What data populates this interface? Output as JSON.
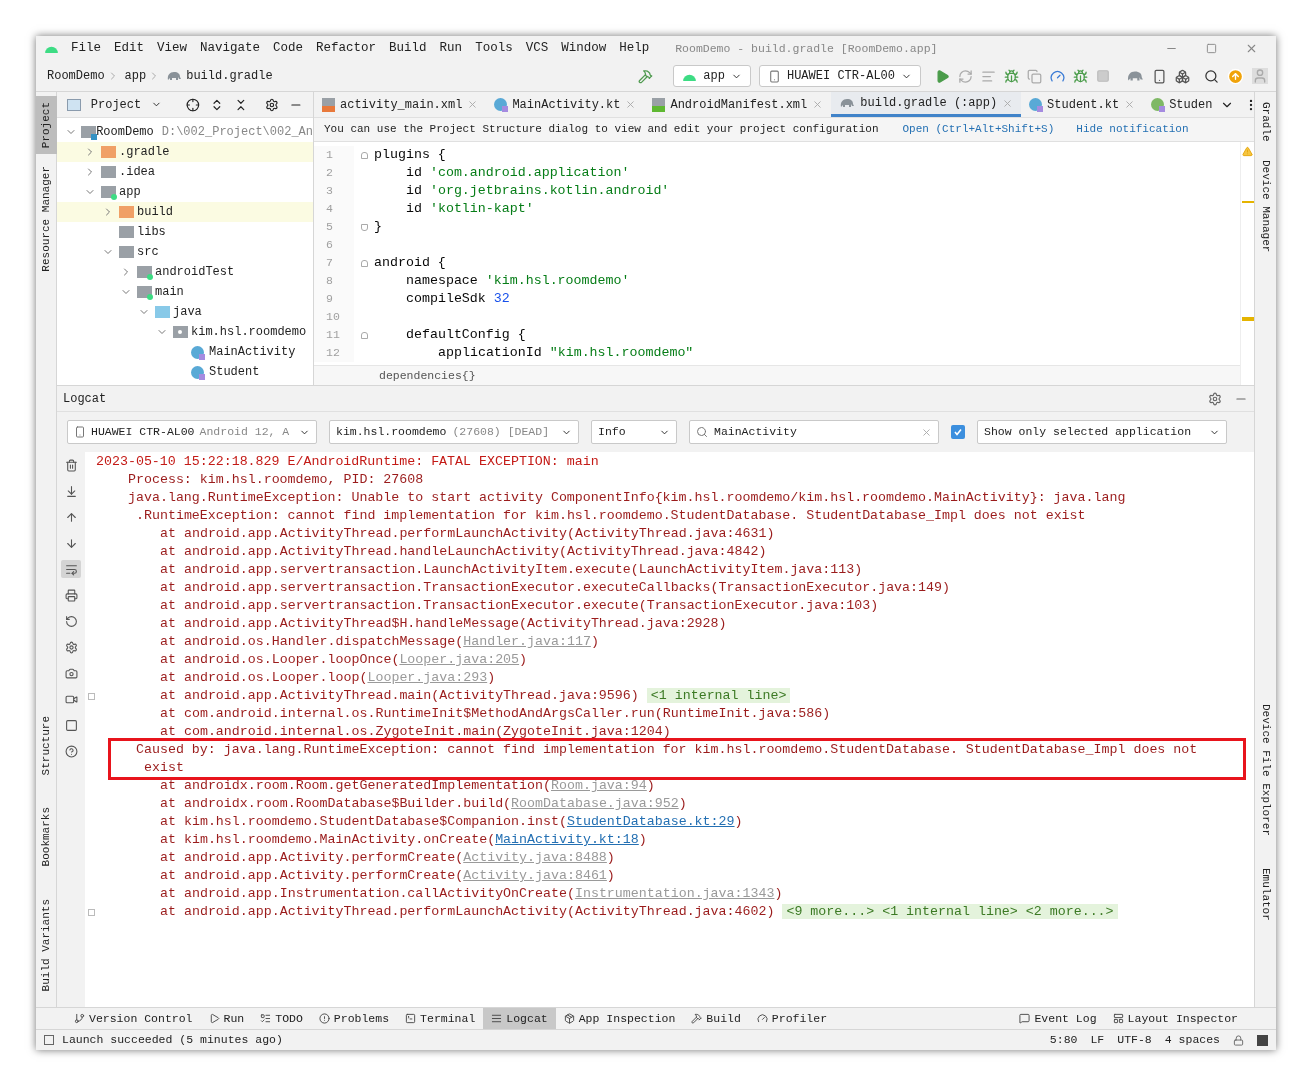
{
  "window": {
    "title": "RoomDemo - build.gradle [RoomDemo.app]"
  },
  "menu": [
    "File",
    "Edit",
    "View",
    "Navigate",
    "Code",
    "Refactor",
    "Build",
    "Run",
    "Tools",
    "VCS",
    "Window",
    "Help"
  ],
  "breadcrumbs": [
    {
      "label": "RoomDemo",
      "kind": "project"
    },
    {
      "label": "app",
      "kind": "module"
    },
    {
      "label": "build.gradle",
      "kind": "gradle"
    }
  ],
  "run_toolbar": {
    "config": "app",
    "device": "HUAWEI CTR-AL00"
  },
  "left_stripe_top": [
    {
      "label": "Project",
      "selected": true
    },
    {
      "label": "Resource Manager",
      "selected": false
    }
  ],
  "left_stripe_bottom": [
    {
      "label": "Structure",
      "selected": false
    },
    {
      "label": "Bookmarks",
      "selected": false
    },
    {
      "label": "Build Variants",
      "selected": false
    }
  ],
  "right_stripe_top": [
    {
      "label": "Gradle",
      "selected": false
    },
    {
      "label": "Device Manager",
      "selected": false
    }
  ],
  "right_stripe_bottom": [
    {
      "label": "Device File Explorer",
      "selected": false
    },
    {
      "label": "Emulator",
      "selected": false
    }
  ],
  "project_panel": {
    "view": "Project",
    "tree": [
      {
        "label": "RoomDemo",
        "detail": "D:\\002_Project\\002_An",
        "kind": "project",
        "expanded": true,
        "children": [
          {
            "label": ".gradle",
            "kind": "excluded",
            "expanded": false
          },
          {
            "label": ".idea",
            "kind": "folder",
            "expanded": false
          },
          {
            "label": "app",
            "kind": "module",
            "expanded": true,
            "children": [
              {
                "label": "build",
                "kind": "excluded",
                "expanded": false
              },
              {
                "label": "libs",
                "kind": "folder"
              },
              {
                "label": "src",
                "kind": "folder",
                "expanded": true,
                "children": [
                  {
                    "label": "androidTest",
                    "kind": "module",
                    "expanded": false
                  },
                  {
                    "label": "main",
                    "kind": "module",
                    "expanded": true,
                    "children": [
                      {
                        "label": "java",
                        "kind": "source",
                        "expanded": true,
                        "children": [
                          {
                            "label": "kim.hsl.roomdemo",
                            "kind": "package",
                            "expanded": true,
                            "children": [
                              {
                                "label": "MainActivity",
                                "kind": "class"
                              },
                              {
                                "label": "Student",
                                "kind": "class"
                              }
                            ]
                          }
                        ]
                      }
                    ]
                  }
                ]
              }
            ]
          }
        ]
      }
    ]
  },
  "editor": {
    "tabs": [
      {
        "label": "activity_main.xml",
        "kind": "xml",
        "selected": false,
        "closable": true
      },
      {
        "label": "MainActivity.kt",
        "kind": "class",
        "selected": false,
        "closable": true
      },
      {
        "label": "AndroidManifest.xml",
        "kind": "manifest",
        "selected": false,
        "closable": true
      },
      {
        "label": "build.gradle (:app)",
        "kind": "gradle",
        "selected": true,
        "closable": true
      },
      {
        "label": "Student.kt",
        "kind": "class",
        "selected": false,
        "closable": true
      },
      {
        "label": "Studen",
        "kind": "interface",
        "selected": false,
        "closable": false
      }
    ],
    "notification": {
      "text": "You can use the Project Structure dialog to view and edit your project configuration",
      "actions": [
        "Open (Ctrl+Alt+Shift+S)",
        "Hide notification"
      ]
    },
    "lines": [
      {
        "number": "1",
        "kind": "block-start",
        "tokens": [
          {
            "text": "plugins {",
            "kind": "plain"
          }
        ]
      },
      {
        "number": "2",
        "kind": "body",
        "tokens": [
          {
            "text": "id ",
            "kind": "plain"
          },
          {
            "text": "'com.android.application'",
            "kind": "string"
          }
        ]
      },
      {
        "number": "3",
        "kind": "body",
        "tokens": [
          {
            "text": "id ",
            "kind": "plain"
          },
          {
            "text": "'org.jetbrains.kotlin.android'",
            "kind": "string"
          }
        ]
      },
      {
        "number": "4",
        "kind": "body",
        "tokens": [
          {
            "text": "id ",
            "kind": "plain"
          },
          {
            "text": "'kotlin-kapt'",
            "kind": "string"
          }
        ]
      },
      {
        "number": "5",
        "kind": "block-end",
        "tokens": [
          {
            "text": "}",
            "kind": "plain"
          }
        ]
      },
      {
        "number": "6",
        "kind": "blank"
      },
      {
        "number": "7",
        "kind": "block-start",
        "tokens": [
          {
            "text": "android {",
            "kind": "plain"
          }
        ]
      },
      {
        "number": "8",
        "kind": "body",
        "tokens": [
          {
            "text": "namespace ",
            "kind": "plain"
          },
          {
            "text": "'kim.hsl.roomdemo'",
            "kind": "string"
          }
        ]
      },
      {
        "number": "9",
        "kind": "body",
        "tokens": [
          {
            "text": "compileSdk ",
            "kind": "plain"
          },
          {
            "text": "32",
            "kind": "number"
          }
        ]
      },
      {
        "number": "10",
        "kind": "blank"
      },
      {
        "number": "11",
        "kind": "nested-block-start",
        "tokens": [
          {
            "text": "defaultConfig {",
            "kind": "plain"
          }
        ]
      },
      {
        "number": "12",
        "kind": "nested-body",
        "tokens": [
          {
            "text": "applicationId ",
            "kind": "plain"
          },
          {
            "text": "\"kim.hsl.roomdemo\"",
            "kind": "string"
          }
        ]
      }
    ],
    "breadcrumb": "dependencies{}"
  },
  "logcat": {
    "title": "Logcat",
    "device": {
      "name": "HUAWEI CTR-AL00",
      "detail": "Android 12, A"
    },
    "process": {
      "name": "kim.hsl.roomdemo",
      "detail": "(27608) [DEAD]"
    },
    "level": "Info",
    "search": "MainActivity",
    "filter_checkbox": {
      "checked": true
    },
    "scope": "Show only selected application",
    "toolbar": [
      {
        "kind": "clear",
        "selected": false
      },
      {
        "kind": "scroll-end",
        "selected": false
      },
      {
        "kind": "up",
        "selected": false
      },
      {
        "kind": "down",
        "selected": false
      },
      {
        "kind": "wrap",
        "selected": true
      },
      {
        "kind": "print",
        "selected": false
      },
      {
        "kind": "restart",
        "selected": false
      },
      {
        "kind": "settings",
        "selected": false
      },
      {
        "kind": "screenshot",
        "selected": false
      },
      {
        "kind": "record",
        "selected": false
      },
      {
        "kind": "stop",
        "selected": false
      },
      {
        "kind": "help",
        "selected": false
      }
    ],
    "lines": [
      {
        "kind": "header",
        "highlighted": false,
        "segments": [
          {
            "text": "2023-05-10 15:22:18.829 E/AndroidRuntime: FATAL EXCEPTION: main",
            "kind": "plain"
          }
        ]
      },
      {
        "kind": "detail",
        "highlighted": false,
        "segments": [
          {
            "text": "Process: kim.hsl.roomdemo, PID: 27608",
            "kind": "plain"
          }
        ]
      },
      {
        "kind": "detail",
        "highlighted": false,
        "segments": [
          {
            "text": "java.lang.RuntimeException: Unable to start activity ComponentInfo{kim.hsl.roomdemo/kim.hsl.roomdemo.MainActivity}: java.lang",
            "kind": "plain"
          }
        ]
      },
      {
        "kind": "continuation",
        "highlighted": false,
        "segments": [
          {
            "text": ".RuntimeException: cannot find implementation for kim.hsl.roomdemo.StudentDatabase. StudentDatabase_Impl does not exist",
            "kind": "plain"
          }
        ]
      },
      {
        "kind": "frame",
        "highlighted": false,
        "segments": [
          {
            "text": "at android.app.ActivityThread.performLaunchActivity(ActivityThread.java:4631)",
            "kind": "plain"
          }
        ]
      },
      {
        "kind": "frame",
        "highlighted": false,
        "segments": [
          {
            "text": "at android.app.ActivityThread.handleLaunchActivity(ActivityThread.java:4842)",
            "kind": "plain"
          }
        ]
      },
      {
        "kind": "frame",
        "highlighted": false,
        "segments": [
          {
            "text": "at android.app.servertransaction.LaunchActivityItem.execute(LaunchActivityItem.java:113)",
            "kind": "plain"
          }
        ]
      },
      {
        "kind": "frame",
        "highlighted": false,
        "segments": [
          {
            "text": "at android.app.servertransaction.TransactionExecutor.executeCallbacks(TransactionExecutor.java:149)",
            "kind": "plain"
          }
        ]
      },
      {
        "kind": "frame",
        "highlighted": false,
        "segments": [
          {
            "text": "at android.app.servertransaction.TransactionExecutor.execute(TransactionExecutor.java:103)",
            "kind": "plain"
          }
        ]
      },
      {
        "kind": "frame",
        "highlighted": false,
        "segments": [
          {
            "text": "at android.app.ActivityThread$H.handleMessage(ActivityThread.java:2928)",
            "kind": "plain"
          }
        ]
      },
      {
        "kind": "frame",
        "highlighted": false,
        "segments": [
          {
            "text": "at android.os.Handler.dispatchMessage(",
            "kind": "plain"
          },
          {
            "text": "Handler.java:117",
            "kind": "muted-link"
          },
          {
            "text": ")",
            "kind": "plain"
          }
        ]
      },
      {
        "kind": "frame",
        "highlighted": false,
        "segments": [
          {
            "text": "at android.os.Looper.loopOnce(",
            "kind": "plain"
          },
          {
            "text": "Looper.java:205",
            "kind": "muted-link"
          },
          {
            "text": ")",
            "kind": "plain"
          }
        ]
      },
      {
        "kind": "frame",
        "highlighted": false,
        "segments": [
          {
            "text": "at android.os.Looper.loop(",
            "kind": "plain"
          },
          {
            "text": "Looper.java:293",
            "kind": "muted-link"
          },
          {
            "text": ")",
            "kind": "plain"
          }
        ]
      },
      {
        "kind": "frame",
        "highlighted": false,
        "foldable": true,
        "segments": [
          {
            "text": "at android.app.ActivityThread.main(ActivityThread.java:9596)",
            "kind": "plain"
          },
          {
            "text": "<1 internal line>",
            "kind": "fold"
          }
        ]
      },
      {
        "kind": "frame",
        "highlighted": false,
        "segments": [
          {
            "text": "at com.android.internal.os.RuntimeInit$MethodAndArgsCaller.run(RuntimeInit.java:586)",
            "kind": "plain"
          }
        ]
      },
      {
        "kind": "frame",
        "highlighted": false,
        "segments": [
          {
            "text": "at com.android.internal.os.ZygoteInit.main(ZygoteInit.java:1204)",
            "kind": "plain"
          }
        ]
      },
      {
        "kind": "continuation",
        "highlighted": true,
        "segments": [
          {
            "text": "Caused by: java.lang.RuntimeException: cannot find implementation for kim.hsl.roomdemo.StudentDatabase. StudentDatabase_Impl does not",
            "kind": "plain"
          }
        ]
      },
      {
        "kind": "wrapped",
        "highlighted": true,
        "segments": [
          {
            "text": "exist",
            "kind": "plain"
          }
        ]
      },
      {
        "kind": "frame",
        "highlighted": false,
        "segments": [
          {
            "text": "at androidx.room.Room.getGeneratedImplementation(",
            "kind": "plain"
          },
          {
            "text": "Room.java:94",
            "kind": "muted-link"
          },
          {
            "text": ")",
            "kind": "plain"
          }
        ]
      },
      {
        "kind": "frame",
        "highlighted": false,
        "segments": [
          {
            "text": "at androidx.room.RoomDatabase$Builder.build(",
            "kind": "plain"
          },
          {
            "text": "RoomDatabase.java:952",
            "kind": "muted-link"
          },
          {
            "text": ")",
            "kind": "plain"
          }
        ]
      },
      {
        "kind": "frame",
        "highlighted": false,
        "segments": [
          {
            "text": "at kim.hsl.roomdemo.StudentDatabase$Companion.inst(",
            "kind": "plain"
          },
          {
            "text": "StudentDatabase.kt:29",
            "kind": "link"
          },
          {
            "text": ")",
            "kind": "plain"
          }
        ]
      },
      {
        "kind": "frame",
        "highlighted": false,
        "segments": [
          {
            "text": "at kim.hsl.roomdemo.MainActivity.onCreate(",
            "kind": "plain"
          },
          {
            "text": "MainActivity.kt:18",
            "kind": "link"
          },
          {
            "text": ")",
            "kind": "plain"
          }
        ]
      },
      {
        "kind": "frame",
        "highlighted": false,
        "segments": [
          {
            "text": "at android.app.Activity.performCreate(",
            "kind": "plain"
          },
          {
            "text": "Activity.java:8488",
            "kind": "muted-link"
          },
          {
            "text": ")",
            "kind": "plain"
          }
        ]
      },
      {
        "kind": "frame",
        "highlighted": false,
        "segments": [
          {
            "text": "at android.app.Activity.performCreate(",
            "kind": "plain"
          },
          {
            "text": "Activity.java:8461",
            "kind": "muted-link"
          },
          {
            "text": ")",
            "kind": "plain"
          }
        ]
      },
      {
        "kind": "frame",
        "highlighted": false,
        "segments": [
          {
            "text": "at android.app.Instrumentation.callActivityOnCreate(",
            "kind": "plain"
          },
          {
            "text": "Instrumentation.java:1343",
            "kind": "muted-link"
          },
          {
            "text": ")",
            "kind": "plain"
          }
        ]
      },
      {
        "kind": "frame",
        "highlighted": false,
        "foldable": true,
        "segments": [
          {
            "text": "at android.app.ActivityThread.performLaunchActivity(ActivityThread.java:4602)",
            "kind": "plain"
          },
          {
            "text": "<9 more...> <1 internal line> <2 more...>",
            "kind": "fold"
          }
        ]
      }
    ]
  },
  "bottom_tools": [
    {
      "label": "Version Control",
      "kind": "vcs",
      "selected": false
    },
    {
      "label": "Run",
      "kind": "run",
      "selected": false
    },
    {
      "label": "TODO",
      "kind": "todo",
      "selected": false
    },
    {
      "label": "Problems",
      "kind": "problems",
      "selected": false
    },
    {
      "label": "Terminal",
      "kind": "terminal",
      "selected": false
    },
    {
      "label": "Logcat",
      "kind": "logcat",
      "selected": true
    },
    {
      "label": "App Inspection",
      "kind": "inspection",
      "selected": false
    },
    {
      "label": "Build",
      "kind": "build",
      "selected": false
    },
    {
      "label": "Profiler",
      "kind": "profiler",
      "selected": false
    }
  ],
  "bottom_tools_right": [
    {
      "label": "Event Log",
      "kind": "event",
      "selected": false
    },
    {
      "label": "Layout Inspector",
      "kind": "layout",
      "selected": false
    }
  ],
  "status_bar": {
    "message": "Launch succeeded (5 minutes ago)",
    "items": [
      "5:80",
      "LF",
      "UTF-8",
      "4 spaces"
    ]
  }
}
